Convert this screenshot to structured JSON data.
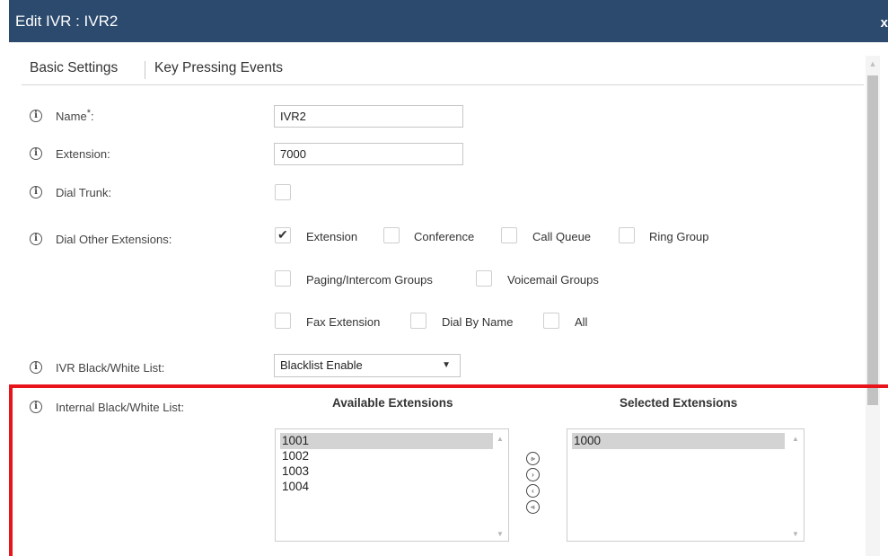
{
  "dialog": {
    "title": "Edit IVR : IVR2",
    "close": "x"
  },
  "tabs": [
    {
      "label": "Basic Settings",
      "active": true
    },
    {
      "label": "Key Pressing Events",
      "active": false
    }
  ],
  "form": {
    "name": {
      "label": "Name",
      "required_mark": "*",
      "colon": ":",
      "value": "IVR2"
    },
    "extension": {
      "label": "Extension:",
      "value": "7000"
    },
    "dial_trunk": {
      "label": "Dial Trunk:",
      "checked": false
    },
    "dial_other": {
      "label": "Dial Other Extensions:",
      "options": [
        {
          "label": "Extension",
          "checked": true
        },
        {
          "label": "Conference",
          "checked": false
        },
        {
          "label": "Call Queue",
          "checked": false
        },
        {
          "label": "Ring Group",
          "checked": false
        },
        {
          "label": "Paging/Intercom Groups",
          "checked": false
        },
        {
          "label": "Voicemail Groups",
          "checked": false
        },
        {
          "label": "Fax Extension",
          "checked": false
        },
        {
          "label": "Dial By Name",
          "checked": false
        },
        {
          "label": "All",
          "checked": false
        }
      ]
    },
    "ivr_bw_list": {
      "label": "IVR Black/White List:",
      "value": "Blacklist Enable"
    },
    "internal_bw_list": {
      "label": "Internal Black/White List:",
      "available_header": "Available Extensions",
      "selected_header": "Selected Extensions",
      "available": [
        "1001",
        "1002",
        "1003",
        "1004"
      ],
      "selected": [
        "1000"
      ],
      "buttons": [
        "move-all-right",
        "move-right",
        "move-left",
        "move-all-left"
      ]
    }
  },
  "icons": {
    "info": "i",
    "up": "▲",
    "down": "▼",
    "move_all_right": "⪢",
    "move_right": "›",
    "move_left": "‹",
    "move_all_left": "⪡"
  },
  "colors": {
    "title_bar": "#2c4a6e",
    "highlight_frame": "#e8141b"
  }
}
